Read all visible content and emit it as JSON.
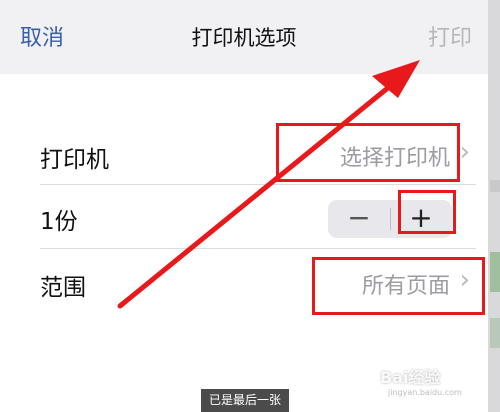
{
  "nav": {
    "cancel_label": "取消",
    "title": "打印机选项",
    "print_label": "打印"
  },
  "options": {
    "printer": {
      "label": "打印机",
      "value": "选择打印机"
    },
    "copies": {
      "label": "1份",
      "minus": "−",
      "plus": "+"
    },
    "range": {
      "label": "范围",
      "value": "所有页面"
    }
  },
  "toast": "已是最后一张",
  "watermark": "Bai经验",
  "watermark_sub": "jingyan.baidu.com",
  "colors": {
    "accent": "#3a5ea8",
    "annotation": "#e8191b",
    "disabled": "#b7b7bb"
  },
  "icons": {
    "chevron": "chevron-right-icon",
    "arrow": "red-arrow-annotation"
  }
}
